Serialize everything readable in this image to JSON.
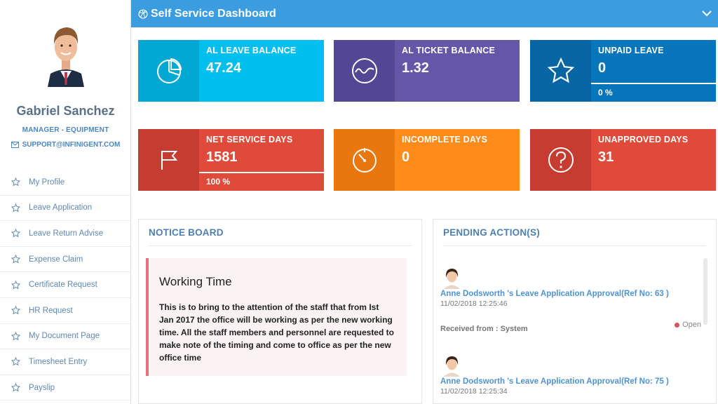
{
  "user": {
    "name": "Gabriel Sanchez",
    "role": "MANAGER - EQUIPMENT",
    "email": "SUPPORT@INFINIGENT.COM"
  },
  "nav": [
    {
      "label": "My Profile",
      "icon": "star-icon"
    },
    {
      "label": "Leave Application",
      "icon": "star-icon"
    },
    {
      "label": "Leave Return Advise",
      "icon": "star-icon"
    },
    {
      "label": "Expense Claim",
      "icon": "star-icon"
    },
    {
      "label": "Certificate Request",
      "icon": "star-icon"
    },
    {
      "label": "HR Request",
      "icon": "star-icon"
    },
    {
      "label": "My Document Page",
      "icon": "star-icon"
    },
    {
      "label": "Timesheet Entry",
      "icon": "star-icon"
    },
    {
      "label": "Payslip",
      "icon": "star-icon"
    }
  ],
  "header": {
    "title": "Self Service Dashboard",
    "icon": "dribbble-icon",
    "color": "#3b9de0"
  },
  "tiles": [
    {
      "label": "AL LEAVE BALANCE",
      "value": "47.24",
      "footer": "",
      "icon": "pie-chart-icon",
      "color": "#00bfee",
      "icon_bg": "#00a8d2"
    },
    {
      "label": "AL TICKET BALANCE",
      "value": "1.32",
      "footer": "",
      "icon": "wave-icon",
      "color": "#6556a8",
      "icon_bg": "#534694"
    },
    {
      "label": "UNPAID LEAVE",
      "value": "0",
      "footer": "0 %",
      "icon": "star-outline-icon",
      "color": "#0675ba",
      "icon_bg": "#0665a2"
    },
    {
      "label": "NET SERVICE DAYS",
      "value": "1581",
      "footer": "100 %",
      "icon": "flag-icon",
      "color": "#e04a3a",
      "icon_bg": "#c63c30"
    },
    {
      "label": "INCOMPLETE DAYS",
      "value": "0",
      "footer": "",
      "icon": "timer-icon",
      "color": "#ff8c1a",
      "icon_bg": "#e8770e"
    },
    {
      "label": "UNAPPROVED DAYS",
      "value": "31",
      "footer": "",
      "icon": "question-icon",
      "color": "#e04a3a",
      "icon_bg": "#c63c30"
    }
  ],
  "notice_board": {
    "title": "NOTICE BOARD",
    "item_title": "Working Time",
    "item_body": "This is to bring to the attention of the staff that from Ist Jan 2017 the office will be working as per the new working time. All the staff members and personnel are requested to make note of the timing and come to office as per the new office time"
  },
  "pending": {
    "title": "PENDING ACTION(S)",
    "items": [
      {
        "title": "Anne Dodsworth 's Leave Application Approval(Ref No: 63 )",
        "time": "11/02/2018 12:25:46",
        "from": "Received from : System",
        "status": "Open"
      },
      {
        "title": "Anne Dodsworth 's Leave Application Approval(Ref No: 75 )",
        "time": "11/02/2018 12:25:34",
        "from": "",
        "status": ""
      }
    ]
  }
}
